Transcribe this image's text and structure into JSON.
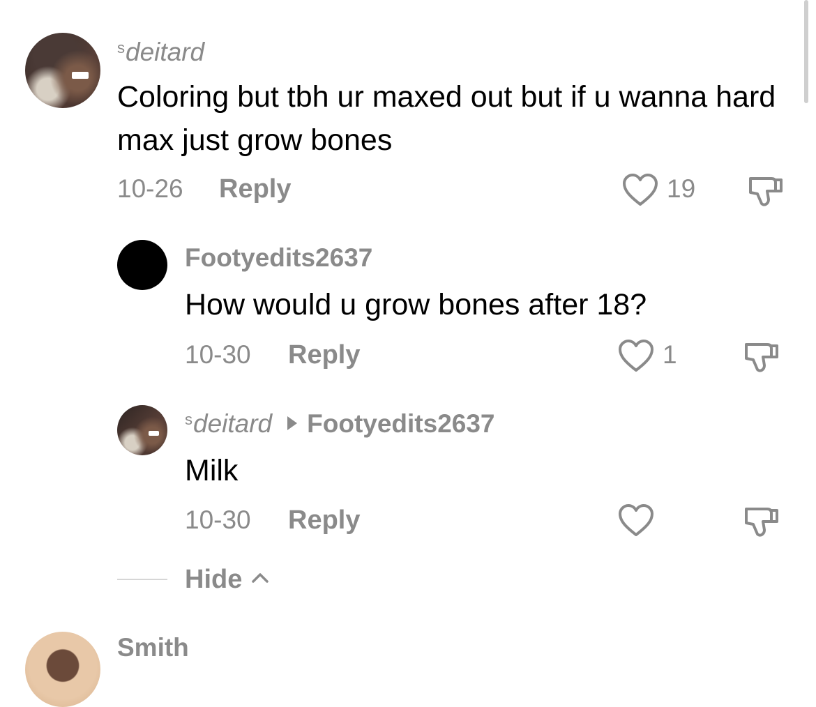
{
  "comments": [
    {
      "username": "deitard",
      "prefix": "s",
      "text": "Coloring but tbh ur maxed out but if u wanna hard max just grow bones",
      "date": "10-26",
      "reply_label": "Reply",
      "likes": "19"
    },
    {
      "username": "Footyedits2637",
      "text": "How would u grow bones after 18?",
      "date": "10-30",
      "reply_label": "Reply",
      "likes": "1"
    },
    {
      "username": "deitard",
      "prefix": "s",
      "reply_to": "Footyedits2637",
      "text": "Milk",
      "date": "10-30",
      "reply_label": "Reply",
      "likes": ""
    }
  ],
  "hide_label": "Hide",
  "next_comment": {
    "username": "Smith"
  },
  "colors": {
    "meta_gray": "#8a8a8a",
    "text": "#000000",
    "background": "#ffffff"
  },
  "icons": [
    "heart-outline-icon",
    "thumbs-down-icon",
    "chevron-up-icon",
    "reply-arrow-icon"
  ]
}
